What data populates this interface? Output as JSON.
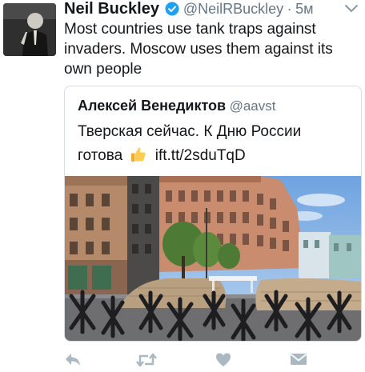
{
  "tweet": {
    "author_name": "Neil Buckley",
    "handle": "@NeilRBuckley",
    "separator": "·",
    "time": "5м",
    "text": "Most countries use tank traps against invaders. Moscow uses them against its own people"
  },
  "quoted_tweet": {
    "author_name": "Алексей Венедиктов",
    "handle": "@aavst",
    "text_line1": "Тверская сейчас. К Дню России",
    "text_word": "готова",
    "link": "ift.tt/2sduTqD"
  },
  "colors": {
    "verified_blue": "#1da1f2",
    "muted": "#657786",
    "retweet_inactive": "#aab8c2"
  },
  "icons": {
    "reply": "reply-icon",
    "retweet": "retweet-icon",
    "like": "heart-icon",
    "dm": "envelope-icon",
    "menu": "chevron-down-icon",
    "verified": "verified-badge-icon",
    "emoji": "thumbs-up-emoji-icon"
  }
}
